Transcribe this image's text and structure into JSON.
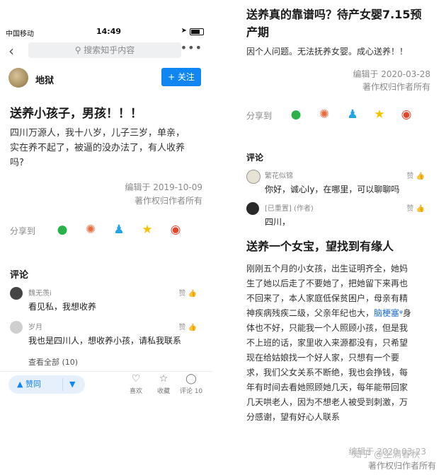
{
  "left": {
    "status": {
      "carrier": "中国移动",
      "time": "14:49"
    },
    "search_placeholder": "搜索知乎内容",
    "author": {
      "name": "地狱",
      "follow_label": "+ 关注"
    },
    "question": {
      "title": "送养小孩子，男孩！！！",
      "lines": [
        "四川万源人，我十八岁，儿子三岁，单亲，",
        "实在养不起了，被逼的没办法了，有人收养",
        "吗?"
      ],
      "edited": "编辑于 2019-10-09",
      "copyright": "著作权归作者所有"
    },
    "share_label": "分享到",
    "comments_title": "评论",
    "comments": [
      {
        "name": "魏无羡i",
        "text": "看见私，我想收养",
        "like": "赞"
      },
      {
        "name": "岁月",
        "text": "我也是四川人，想收养小孩，请私我联系",
        "like": "赞"
      }
    ],
    "view_all": "查看全部 (10)",
    "bottom": {
      "vote_up": "赞同",
      "like": "喜欢",
      "collect": "收藏",
      "comment": "评论 10"
    }
  },
  "right": {
    "title_lines": [
      "送养真的靠谱吗？待产女婴7.15预",
      "产期"
    ],
    "body": "因个人问题。无法抚养女婴。成心送养！！",
    "edited": "编辑于 2020-03-28",
    "copyright": "著作权归作者所有",
    "share_label": "分享到",
    "comments_title": "评论",
    "comments": [
      {
        "name": "繁花似锦",
        "text": "你好，诚心ly，在哪里，可以聊聊吗",
        "like": "赞"
      },
      {
        "name": "[已重置] (作者)",
        "text": "四川，",
        "like": "赞"
      }
    ],
    "title2": "送养一个女宝，望找到有缘人",
    "body2_lines": [
      "刚刚五个月的小女孩，出生证明齐全，她妈",
      "生了她以后走了不要她了，把她留下来再也",
      "不回来了，本人家庭低保贫困户，母亲有精",
      "神疾病残疾二级，父亲年纪也大，",
      "体也不好，只能我一个人照顾小孩，但是我",
      "不上班的话，家里收入来源都没有，只希望",
      "现在给姑娘找一个好人家，只想有一个要",
      "求，我们父女关系不断绝，我也会挣钱，每",
      "年有时间去看她照顾她几天，每年能带回家",
      "几天哄老人，因为不想老人被受到刺激，万",
      "分感谢，望有好心人联系"
    ],
    "body2_link": "脑梗塞",
    "body2_line4_tail": "身",
    "edited2": "编辑于 2020-03-23",
    "copyright2": "著作权归作者所有",
    "watermark": "知乎 @尘满春秋"
  }
}
